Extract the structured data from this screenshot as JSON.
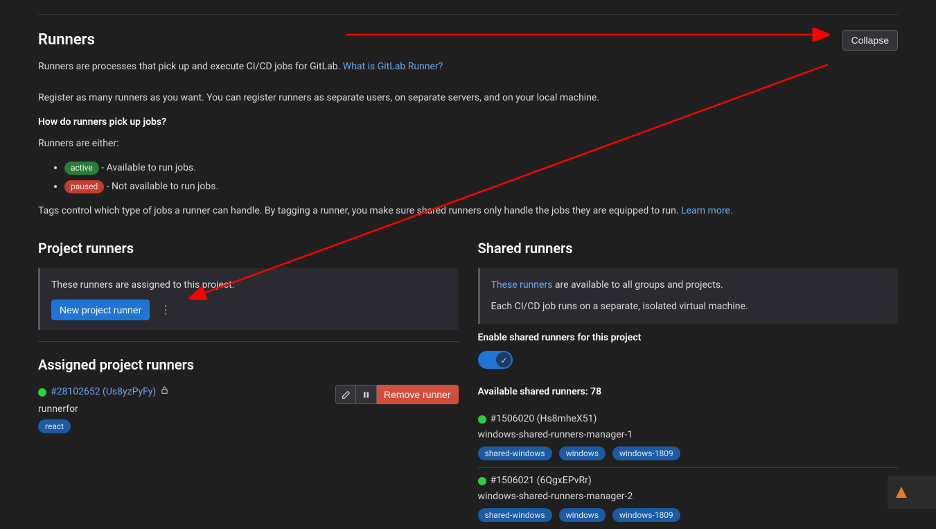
{
  "header": {
    "title": "Runners",
    "collapse_label": "Collapse"
  },
  "intro": {
    "line1": "Runners are processes that pick up and execute CI/CD jobs for GitLab. ",
    "link1": "What is GitLab Runner?",
    "line2": "Register as many runners as you want. You can register runners as separate users, on separate servers, and on your local machine.",
    "how_q": "How do runners pick up jobs?",
    "either": "Runners are either:",
    "active_badge": "active",
    "active_desc": " - Available to run jobs.",
    "paused_badge": "paused",
    "paused_desc": " - Not available to run jobs.",
    "tags_line": "Tags control which type of jobs a runner can handle. By tagging a runner, you make sure shared runners only handle the jobs they are equipped to run. ",
    "learn_more": "Learn more."
  },
  "project_runners": {
    "title": "Project runners",
    "panel_line": "These runners are assigned to this project.",
    "new_btn": "New project runner"
  },
  "assigned": {
    "title": "Assigned project runners",
    "runner_id": "#28102652 (Us8yzPyFy)",
    "desc": "runnerfor",
    "tag": "react",
    "remove_label": "Remove runner"
  },
  "shared": {
    "title": "Shared runners",
    "panel_link": "These runners",
    "panel_rest": " are available to all groups and projects.",
    "panel_line2": "Each CI/CD job runs on a separate, isolated virtual machine.",
    "enable_label": "Enable shared runners for this project",
    "available_prefix": "Available shared runners: ",
    "available_count": "78",
    "runners": [
      {
        "id": "#1506020 (Hs8mheX51)",
        "name": "windows-shared-runners-manager-1",
        "tags": [
          "shared-windows",
          "windows",
          "windows-1809"
        ]
      },
      {
        "id": "#1506021 (6QgxEPvRr)",
        "name": "windows-shared-runners-manager-2",
        "tags": [
          "shared-windows",
          "windows",
          "windows-1809"
        ]
      }
    ]
  }
}
